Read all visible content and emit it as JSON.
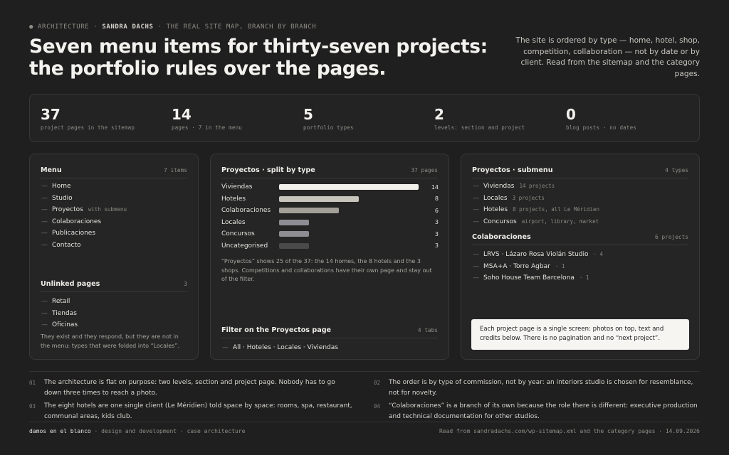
{
  "header": {
    "eyebrow_prefix": "● ARCHITECTURE ·",
    "eyebrow_name": "SANDRA DACHS",
    "eyebrow_suffix": "· THE REAL SITE MAP, BRANCH BY BRANCH",
    "headline": "Seven menu items for thirty-seven projects: the portfolio rules over the pages.",
    "intro": "The site is ordered by type — home, hotel, shop, competition, collaboration — not by date or by client. Read from the sitemap and the category pages."
  },
  "stats": [
    {
      "value": "37",
      "label": "project pages in the sitemap"
    },
    {
      "value": "14",
      "label": "pages · 7 in the menu"
    },
    {
      "value": "5",
      "label": "portfolio types"
    },
    {
      "value": "2",
      "label": "levels: section and project"
    },
    {
      "value": "0",
      "label": "blog posts · no dates"
    }
  ],
  "menu_card": {
    "title": "Menu",
    "count": "7 items",
    "items": [
      {
        "label": "Home",
        "note": ""
      },
      {
        "label": "Studio",
        "note": ""
      },
      {
        "label": "Proyectos",
        "note": "with submenu"
      },
      {
        "label": "Colaboraciones",
        "note": ""
      },
      {
        "label": "Publicaciones",
        "note": ""
      },
      {
        "label": "Contacto",
        "note": ""
      }
    ],
    "unlinked_title": "Unlinked pages",
    "unlinked_count": "3",
    "unlinked_items": [
      "Retail",
      "Tiendas",
      "Oficinas"
    ],
    "unlinked_text": "They exist and they respond, but they are not in the menu: types that were folded into “Locales”."
  },
  "proyectos_card": {
    "title": "Proyectos · split by type",
    "count": "37 pages",
    "colors": {
      "viviendas": "#f2f0eb",
      "hoteles": "#c7c4bc",
      "colaboraciones": "#a3a09a",
      "locales": "#8d8d93",
      "concursos": "#8d8d93",
      "uncategorised": "#4a4a4a"
    },
    "chart_data": {
      "type": "bar",
      "categories": [
        "Viviendas",
        "Hoteles",
        "Colaboraciones",
        "Locales",
        "Concursos",
        "Uncategorised"
      ],
      "values": [
        14,
        8,
        6,
        3,
        3,
        3
      ]
    },
    "text": "“Proyectos” shows 25 of the 37: the 14 homes, the 8 hotels and the 3 shops. Competitions and collaborations have their own page and stay out of the filter.",
    "filter_title": "Filter on the Proyectos page",
    "filter_count": "4 tabs",
    "filter_tabs": "All · Hoteles · Locales · Viviendas"
  },
  "submenu_card": {
    "title": "Proyectos · submenu",
    "count": "4 types",
    "items": [
      {
        "label": "Viviendas",
        "note": "14 projects"
      },
      {
        "label": "Locales",
        "note": "3 projects"
      },
      {
        "label": "Hoteles",
        "note": "8 projects, all Le Méridien"
      },
      {
        "label": "Concursos",
        "note": "airport, library, market"
      }
    ],
    "collab_title": "Colaboraciones",
    "collab_count": "6 projects",
    "collab_items": [
      {
        "label": "LRVS · Lázaro Rosa Violán Studio",
        "note": "· 4"
      },
      {
        "label": "MSA+A · Torre Agbar",
        "note": "· 1"
      },
      {
        "label": "Soho House Team Barcelona",
        "note": "· 1"
      }
    ],
    "box": "Each project page is a single screen: photos on top, text and credits below. There is no pagination and no “next project”."
  },
  "footnotes": [
    {
      "n": "01",
      "text": "The architecture is flat on purpose: two levels, section and project page. Nobody has to go down three times to reach a photo."
    },
    {
      "n": "02",
      "text": "The order is by type of commission, not by year: an interiors studio is chosen for resemblance, not for novelty."
    },
    {
      "n": "03",
      "text": "The eight hotels are one single client (Le Méridien) told space by space: rooms, spa, restaurant, communal areas, kids club."
    },
    {
      "n": "04",
      "text": "“Colaboraciones” is a branch of its own because the role there is different: executive production and technical documentation for other studios."
    }
  ],
  "footer": {
    "brand": "damos en el blanco",
    "left": "· design and development · case architecture",
    "right": "Read from sandradachs.com/wp-sitemap.xml and the category pages · 14.09.2026"
  }
}
